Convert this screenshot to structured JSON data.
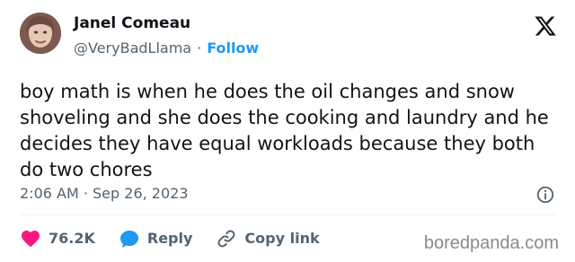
{
  "author": {
    "name": "Janel Comeau",
    "handle": "@VeryBadLlama",
    "follow_label": "Follow",
    "separator": "·"
  },
  "tweet": {
    "text": "boy math is when he does the oil changes and snow shoveling and she does the cooking and laundry and he decides they have equal workloads because they both do two chores",
    "timestamp": "2:06 AM · Sep 26, 2023"
  },
  "actions": {
    "likes_count": "76.2K",
    "reply_label": "Reply",
    "copy_link_label": "Copy link"
  },
  "icons": {
    "brand": "x-logo-icon",
    "info": "info-icon",
    "like": "heart-icon",
    "reply": "speech-bubble-icon",
    "copy_link": "link-icon"
  },
  "colors": {
    "text": "#0f1419",
    "muted": "#536471",
    "accent": "#1d9bf0",
    "like": "#f91880",
    "divider": "#eff3f4"
  },
  "watermark": {
    "text": "boredpanda.com"
  }
}
